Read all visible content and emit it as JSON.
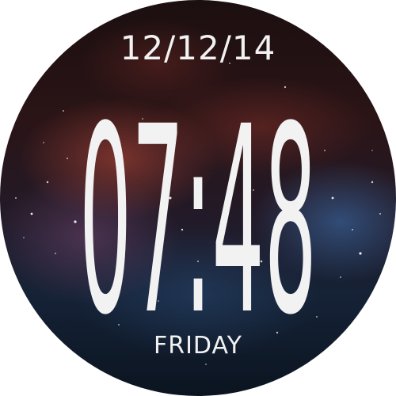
{
  "watch": {
    "date": "12/12/14",
    "time": "07:48",
    "day": "FRIDAY",
    "text_color": "#f2f2f2",
    "background": "galaxy nebula"
  }
}
